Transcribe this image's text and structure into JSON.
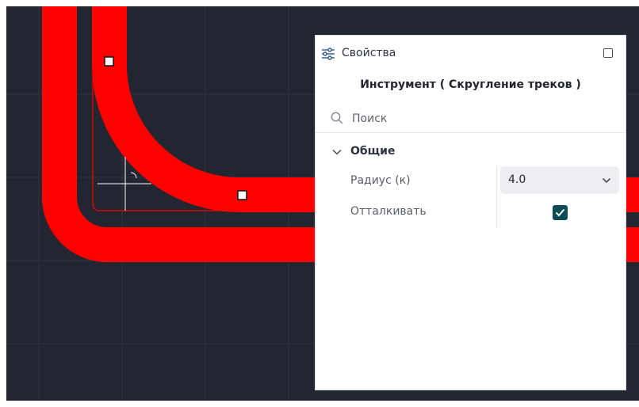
{
  "colors": {
    "canvas_background": "#212630",
    "grid_line": "#2e3440",
    "track": "#ff0000",
    "checkbox": "#0f4c57"
  },
  "panel": {
    "title": "Свойства",
    "tool_title": "Инструмент ( Скругление треков )",
    "search": {
      "placeholder": "Поиск",
      "value": ""
    },
    "group": {
      "label": "Общие",
      "expanded": true
    },
    "properties": {
      "radius": {
        "label": "Радиус (к)",
        "value": "4.0"
      },
      "repel": {
        "label": "Отталкивать",
        "checked": true
      }
    }
  },
  "icons": {
    "header": "sliders-icon",
    "maximize": "maximize-icon",
    "search": "search-icon",
    "group_toggle": "chevron-down-icon",
    "select_toggle": "chevron-down-icon",
    "checkbox": "checkmark-icon"
  }
}
